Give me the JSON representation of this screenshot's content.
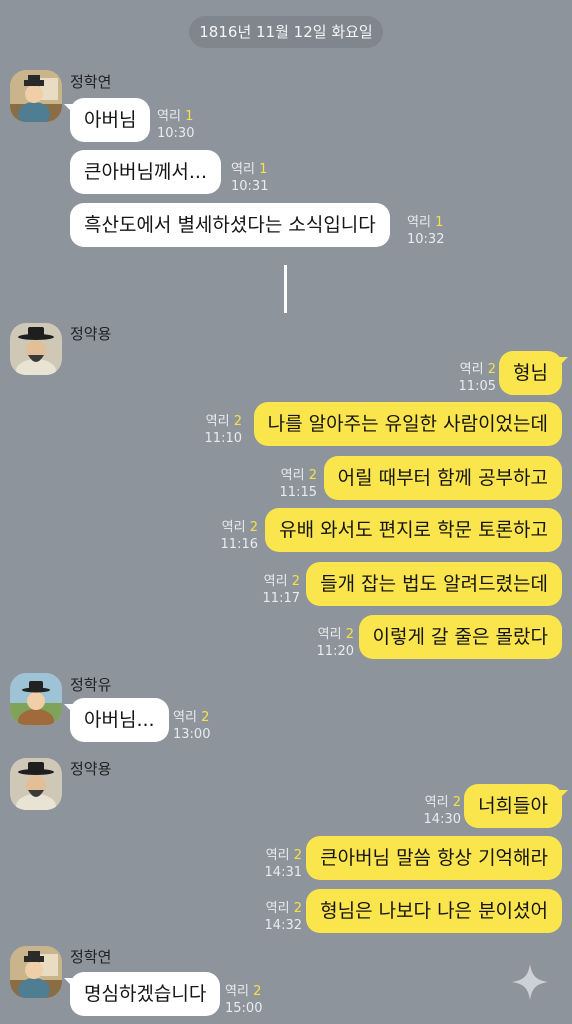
{
  "date": "1816년 11월 12일 화요일",
  "senders": {
    "hakyeon": "정학연",
    "yakyong": "정약용",
    "hakyu": "정학유"
  },
  "read_label": "역리",
  "messages": [
    {
      "text": "아버님",
      "read": "1",
      "time": "10:30"
    },
    {
      "text": "큰아버님께서...",
      "read": "1",
      "time": "10:31"
    },
    {
      "text": "흑산도에서 별세하셨다는 소식입니다",
      "read": "1",
      "time": "10:32"
    },
    {
      "text": "형님",
      "read": "2",
      "time": "11:05"
    },
    {
      "text": "나를 알아주는 유일한 사람이었는데",
      "read": "2",
      "time": "11:10"
    },
    {
      "text": "어릴 때부터 함께 공부하고",
      "read": "2",
      "time": "11:15"
    },
    {
      "text": "유배 와서도 편지로 학문 토론하고",
      "read": "2",
      "time": "11:16"
    },
    {
      "text": "들개 잡는 법도 알려드렸는데",
      "read": "2",
      "time": "11:17"
    },
    {
      "text": "이렇게 갈 줄은 몰랐다",
      "read": "2",
      "time": "11:20"
    },
    {
      "text": "아버님...",
      "read": "2",
      "time": "13:00"
    },
    {
      "text": "너희들아",
      "read": "2",
      "time": "14:30"
    },
    {
      "text": "큰아버님 말씀 항상 기억해라",
      "read": "2",
      "time": "14:31"
    },
    {
      "text": "형님은 나보다 나은 분이셨어",
      "read": "2",
      "time": "14:32"
    },
    {
      "text": "명심하겠습니다",
      "read": "2",
      "time": "15:00"
    }
  ],
  "icons": {
    "avatar_hakyeon": "scholar-avatar-icon",
    "avatar_yakyong": "elder-avatar-icon",
    "avatar_hakyu": "young-scholar-avatar-icon",
    "sparkle": "sparkle-icon"
  },
  "colors": {
    "background": "#8e949b",
    "incoming_bubble": "#ffffff",
    "outgoing_bubble": "#fbe54d",
    "unread_count": "#f6e04a"
  }
}
